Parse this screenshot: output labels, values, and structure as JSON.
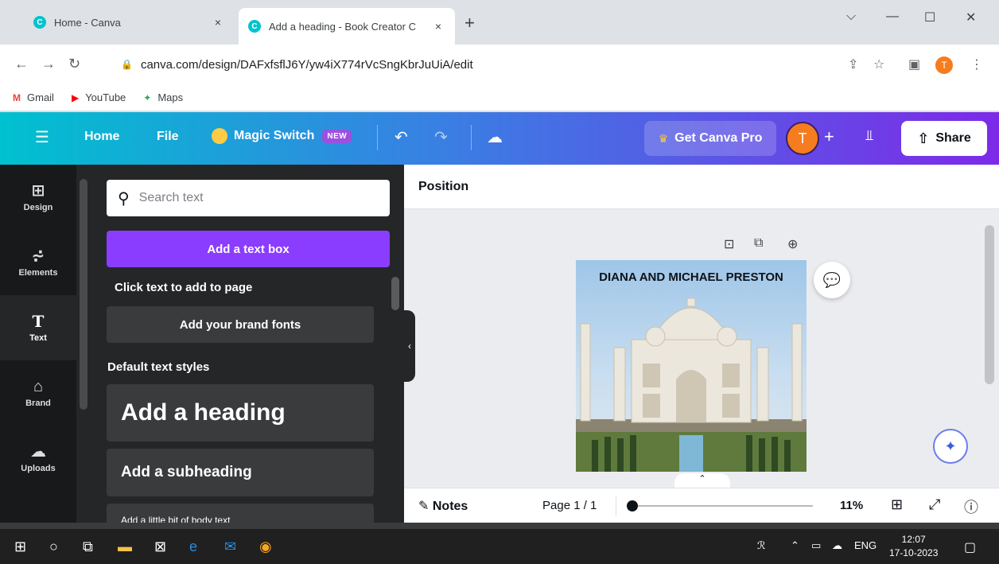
{
  "browser": {
    "tabs": [
      {
        "title": "Home - Canva",
        "close": "×"
      },
      {
        "title": "Add a heading - Book Creator C",
        "close": "×"
      }
    ],
    "new_tab": "+",
    "window_controls": {
      "chevron": "⌵",
      "minimize": "—",
      "maximize": "☐",
      "close": "✕"
    },
    "address": "canva.com/design/DAFxfsflJ6Y/yw4iX774rVcSngKbrJuUiA/edit",
    "profile_initial": "T",
    "bookmarks": [
      {
        "label": "Gmail",
        "icon": "gmail-icon"
      },
      {
        "label": "YouTube",
        "icon": "youtube-icon"
      },
      {
        "label": "Maps",
        "icon": "maps-icon"
      }
    ]
  },
  "canva_header": {
    "home": "Home",
    "file": "File",
    "magic_switch": "Magic Switch",
    "new_badge": "NEW",
    "get_pro": "Get Canva Pro",
    "avatar_initial": "T",
    "add": "+",
    "share": "Share"
  },
  "rail": {
    "items": [
      {
        "label": "Design",
        "icon": "design-icon"
      },
      {
        "label": "Elements",
        "icon": "elements-icon"
      },
      {
        "label": "Text",
        "icon": "text-icon"
      },
      {
        "label": "Brand",
        "icon": "brand-icon"
      },
      {
        "label": "Uploads",
        "icon": "uploads-icon"
      }
    ]
  },
  "text_panel": {
    "search_placeholder": "Search text",
    "add_text_box": "Add a text box",
    "hint": "Click text to add to page",
    "brand_fonts": "Add your brand fonts",
    "default_styles": "Default text styles",
    "heading": "Add a heading",
    "subheading": "Add a subheading",
    "body": "Add a little bit of body text"
  },
  "editor": {
    "context_label": "Position",
    "page_title": "DIANA AND MICHAEL PRESTON",
    "notes": "Notes",
    "page_indicator": "Page 1 / 1",
    "zoom": "11%",
    "zoom_level": 0.11
  },
  "taskbar": {
    "language": "ENG",
    "time": "12:07",
    "date": "17-10-2023"
  },
  "colors": {
    "accent_purple": "#8b3dff",
    "header_gradient_start": "#00c1cf",
    "header_gradient_end": "#7d2ae8",
    "avatar_orange": "#f57c1f"
  }
}
